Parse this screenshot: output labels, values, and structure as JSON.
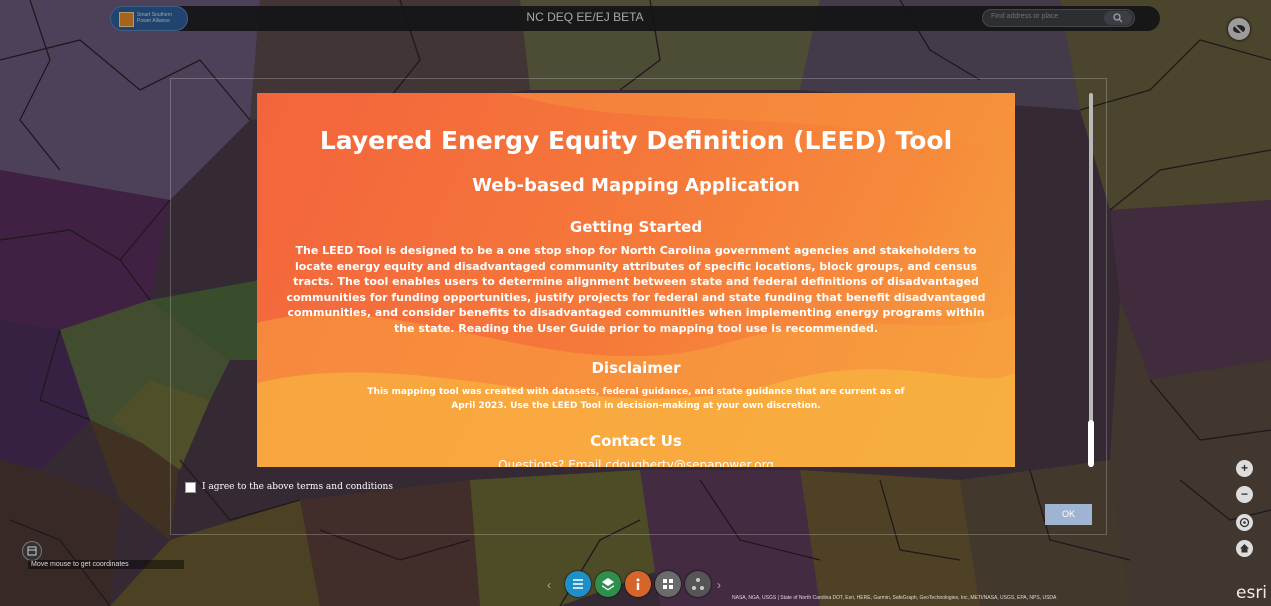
{
  "header": {
    "title": "NC DEQ EE/EJ BETA",
    "logo_text": "Smart Southern Power Alliance",
    "search_placeholder": "Find address or place"
  },
  "dialog": {
    "title": "Layered Energy Equity Definition (LEED) Tool",
    "subtitle": "Web-based Mapping Application",
    "getting_started_heading": "Getting Started",
    "getting_started_body": "The LEED Tool is designed to be a one stop shop for North Carolina government agencies and stakeholders to locate energy equity and disadvantaged community attributes of specific locations, block groups, and census tracts. The tool enables users to determine alignment between state and federal definitions of disadvantaged communities for funding opportunities, justify projects for federal and state funding that benefit disadvantaged communities, and consider benefits to disadvantaged communities when implementing energy programs within the state. Reading the User Guide prior to mapping tool use is recommended.",
    "disclaimer_heading": "Disclaimer",
    "disclaimer_body": "This mapping tool was created with datasets, federal guidance, and state guidance that are current as of April 2023. Use the LEED Tool in decision-making at your own discretion.",
    "contact_heading": "Contact Us",
    "contact_body": "Questions? Email cdougherty@sepapower.org",
    "agree_label": "I agree to the above terms and conditions",
    "ok_label": "OK"
  },
  "map": {
    "coordinates_label": "Move mouse to get coordinates",
    "attribution": "NASA, NGA, USGS | State of North Carolina DOT, Esri, HERE, Garmin, SafeGraph, GeoTechnologies, Inc, METI/NASA, USGS, EPA, NPS, USDA",
    "esri_logo": "esri",
    "zoom_in": "+",
    "zoom_out": "−"
  },
  "colors": {
    "hero_start": "#f4643c",
    "hero_end": "#f6a23e",
    "ok_button": "#9fb3d3",
    "topbar": "#1c1c20"
  }
}
